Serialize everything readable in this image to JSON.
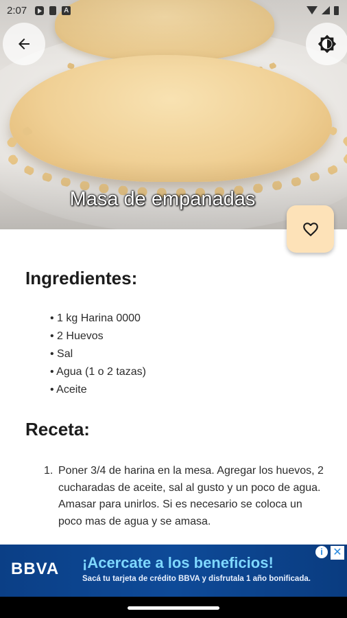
{
  "status_bar": {
    "time": "2:07",
    "left_icons": [
      "play-protect-icon",
      "sd-card-icon",
      "app-notification-icon"
    ],
    "right_icons": [
      "wifi-icon",
      "signal-icon",
      "battery-icon"
    ]
  },
  "hero": {
    "title": "Masa de empanadas",
    "back_icon": "arrow-left-icon",
    "theme_icon": "brightness-icon",
    "favorite_icon": "heart-outline-icon"
  },
  "ingredients": {
    "heading": "Ingredientes:",
    "items": [
      "1 kg Harina 0000",
      "2 Huevos",
      "Sal",
      "Agua (1 o 2 tazas)",
      "Aceite"
    ]
  },
  "recipe": {
    "heading": "Receta:",
    "steps": [
      {
        "number": "1.",
        "text": "Poner 3/4 de harina en la mesa. Agregar los huevos, 2 cucharadas de aceite, sal al gusto y un poco de agua. Amasar para unirlos. Si es necesario se coloca un poco mas de agua y se amasa."
      }
    ]
  },
  "ad": {
    "brand": "BBVA",
    "headline": "¡Acercate a los beneficios!",
    "subline": "Sacá tu tarjeta de crédito BBVA y disfrutala 1 año bonificada.",
    "info_glyph": "i",
    "close_glyph": "✕"
  },
  "colors": {
    "accent_fab": "#fde2b8",
    "ad_background": "#0e4a98",
    "ad_headline": "#7fd8ff"
  }
}
